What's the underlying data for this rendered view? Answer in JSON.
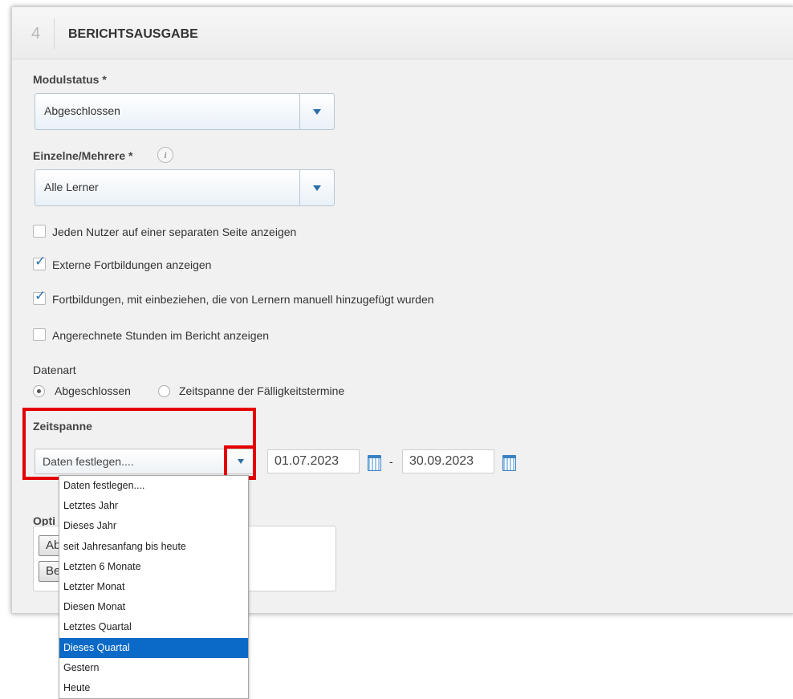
{
  "section": {
    "number": "4",
    "title": "BERICHTSAUSGABE"
  },
  "modulstatus": {
    "label": "Modulstatus *",
    "value": "Abgeschlossen"
  },
  "einzelne": {
    "label": "Einzelne/Mehrere *",
    "info_icon": "info-icon",
    "value": "Alle Lerner"
  },
  "checkboxes": [
    {
      "label": "Jeden Nutzer auf einer separaten Seite anzeigen",
      "checked": false
    },
    {
      "label": "Externe Fortbildungen anzeigen",
      "checked": true
    },
    {
      "label": "Fortbildungen, mit einbeziehen, die von Lernern manuell hinzugefügt wurden",
      "checked": true
    },
    {
      "label": "Angerechnete Stunden im Bericht anzeigen",
      "checked": false
    }
  ],
  "datenart": {
    "label": "Datenart",
    "options": [
      {
        "label": "Abgeschlossen",
        "selected": true
      },
      {
        "label": "Zeitspanne der Fälligkeitstermine",
        "selected": false
      }
    ]
  },
  "zeitspanne": {
    "label": "Zeitspanne",
    "value": "Daten festlegen....",
    "from": "01.07.2023",
    "separator": "-",
    "to": "30.09.2023"
  },
  "options_section": {
    "label_visible": "Opti",
    "btn1": "Ab",
    "btn2": "Be"
  },
  "dropdown_items": [
    "Daten festlegen....",
    "Letztes Jahr",
    "Dieses Jahr",
    "seit Jahresanfang bis heute",
    "Letzten 6 Monate",
    "Letzter Monat",
    "Diesen Monat",
    "Letztes Quartal",
    "Dieses Quartal",
    "Gestern",
    "Heute"
  ],
  "dropdown_selected": "Dieses Quartal",
  "colors": {
    "accent": "#0b6ac7",
    "highlight": "#e30000",
    "arrow": "#2a6ea6"
  }
}
